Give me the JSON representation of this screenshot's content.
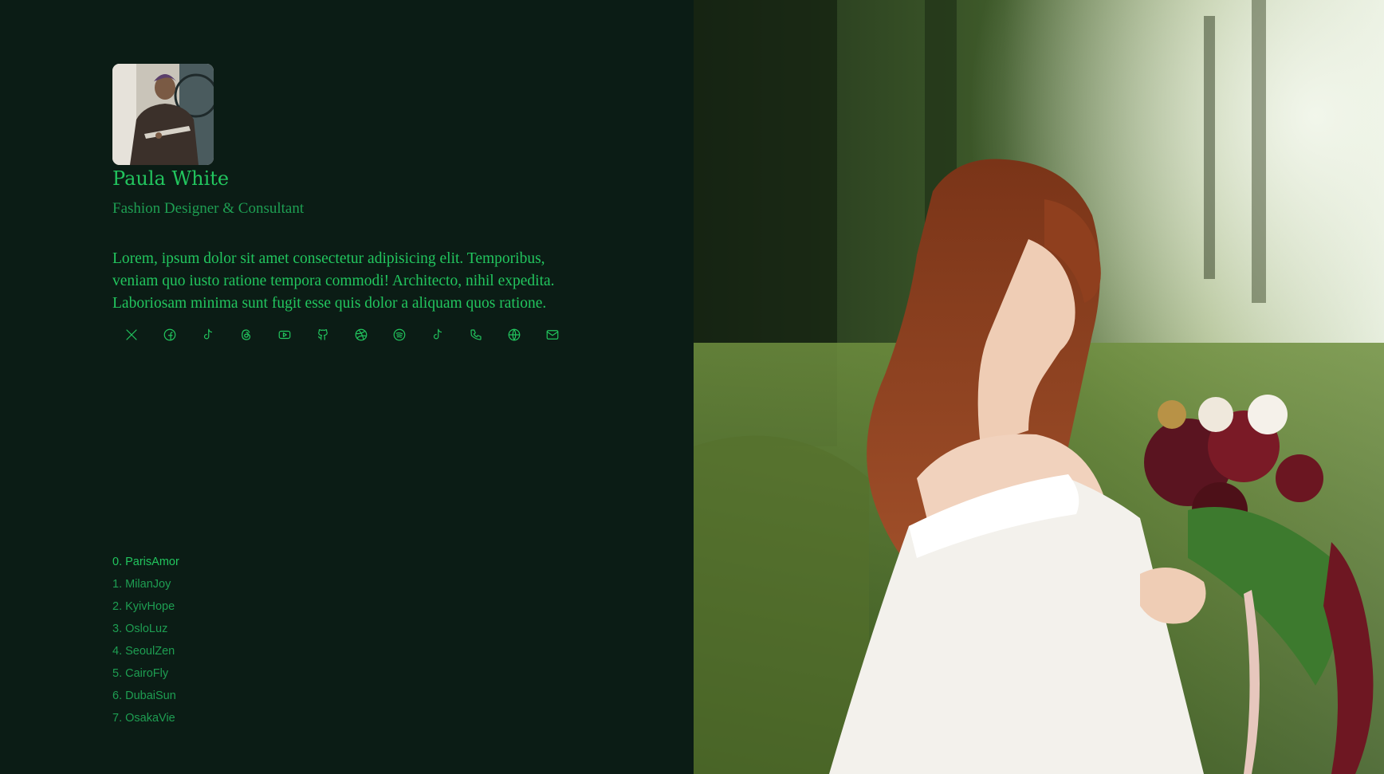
{
  "profile": {
    "name": "Paula White",
    "role": "Fashion Designer & Consultant",
    "bio": "Lorem, ipsum dolor sit amet consectetur adipisicing elit. Temporibus, veniam quo iusto ratione tempora commodi! Architecto, nihil expedita. Laboriosam minima sunt fugit esse quis dolor a aliquam quos ratione."
  },
  "socials": [
    {
      "icon": "x-icon"
    },
    {
      "icon": "facebook-icon"
    },
    {
      "icon": "tiktok-icon"
    },
    {
      "icon": "threads-icon"
    },
    {
      "icon": "youtube-icon"
    },
    {
      "icon": "github-icon"
    },
    {
      "icon": "dribbble-icon"
    },
    {
      "icon": "spotify-icon"
    },
    {
      "icon": "tiktok-icon"
    },
    {
      "icon": "phone-icon"
    },
    {
      "icon": "globe-icon"
    },
    {
      "icon": "mail-icon"
    }
  ],
  "list": {
    "active_index": 0,
    "items": [
      "0. ParisAmor",
      "1. MilanJoy",
      "2. KyivHope",
      "3. OsloLuz",
      "4. SeoulZen",
      "5. CairoFly",
      "6. DubaiSun",
      "7. OsakaVie"
    ]
  },
  "colors": {
    "background": "#0b1c15",
    "accent": "#22c55e",
    "muted": "#1e9e52"
  }
}
